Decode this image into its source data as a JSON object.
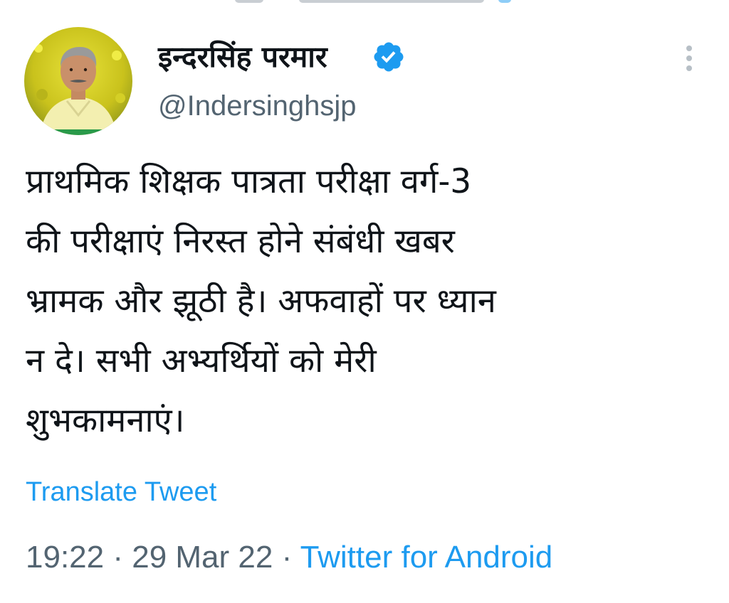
{
  "tweet": {
    "author": {
      "display_name": "इन्दरसिंह परमार",
      "handle": "@Indersinghsjp",
      "verified_icon": "verified-badge-icon",
      "avatar_icon": "avatar"
    },
    "more_icon": "more-options-icon",
    "text": "प्राथमिक शिक्षक पात्रता परीक्षा वर्ग-3\nकी परीक्षाएं निरस्त होने संबंधी खबर\nभ्रामक और झूठी है। अफवाहों पर ध्यान\nन दे। सभी अभ्यर्थियों को मेरी\nशुभकामनाएं।",
    "translate_label": "Translate Tweet",
    "time": "19:22",
    "date": "29 Mar 22",
    "separator": "·",
    "source": "Twitter for Android"
  },
  "colors": {
    "text": "#0f1419",
    "secondary": "#536471",
    "link": "#1d9bf0",
    "verified": "#1d9bf0"
  }
}
